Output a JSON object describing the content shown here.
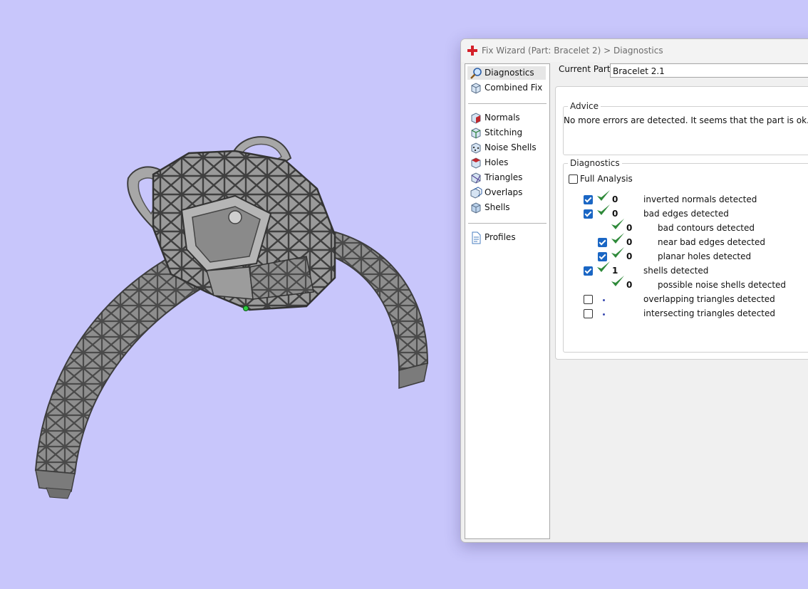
{
  "window": {
    "title": "Fix Wizard (Part: Bracelet 2) > Diagnostics",
    "icon": "red-cross-icon"
  },
  "nav": {
    "items": [
      {
        "label": "Diagnostics",
        "icon": "magnifier-icon",
        "selected": true
      },
      {
        "label": "Combined Fix",
        "icon": "cube-icon"
      },
      {
        "label": "Normals",
        "icon": "red-face-cube-icon"
      },
      {
        "label": "Stitching",
        "icon": "stitch-cube-icon"
      },
      {
        "label": "Noise Shells",
        "icon": "dotted-cube-icon"
      },
      {
        "label": "Holes",
        "icon": "hole-cube-icon"
      },
      {
        "label": "Triangles",
        "icon": "triangle-cube-icon"
      },
      {
        "label": "Overlaps",
        "icon": "overlap-cube-icon"
      },
      {
        "label": "Shells",
        "icon": "shell-cube-icon"
      },
      {
        "label": "Profiles",
        "icon": "document-icon"
      }
    ]
  },
  "current_part": {
    "label": "Current Part:",
    "value": "Bracelet 2.1"
  },
  "advice": {
    "title": "Advice",
    "text": "No more errors are detected. It seems that the part is ok. Note that r"
  },
  "diagnostics": {
    "title": "Diagnostics",
    "full_analysis": {
      "label": "Full Analysis",
      "checked": false
    },
    "rows": [
      {
        "checked": true,
        "status": "ok",
        "count": "0",
        "label": "inverted normals detected"
      },
      {
        "checked": true,
        "status": "ok",
        "count": "0",
        "label": "bad edges detected"
      },
      {
        "checked": null,
        "status": "ok",
        "count": "0",
        "label": "bad contours detected"
      },
      {
        "checked": true,
        "status": "ok",
        "count": "0",
        "label": "near bad edges detected"
      },
      {
        "checked": true,
        "status": "ok",
        "count": "0",
        "label": "planar holes detected"
      },
      {
        "checked": true,
        "status": "ok",
        "count": "1",
        "label": "shells detected"
      },
      {
        "checked": null,
        "status": "ok",
        "count": "0",
        "label": "possible noise shells detected"
      },
      {
        "checked": false,
        "status": "not-run",
        "count": "",
        "label": "overlapping triangles detected"
      },
      {
        "checked": false,
        "status": "not-run",
        "count": "",
        "label": "intersecting triangles detected"
      }
    ]
  },
  "colors": {
    "background": "#c8c6fb",
    "checkbox_accent": "#1a66c4",
    "tick_green": "#2f8a3a",
    "title_icon_red": "#d4202a"
  }
}
